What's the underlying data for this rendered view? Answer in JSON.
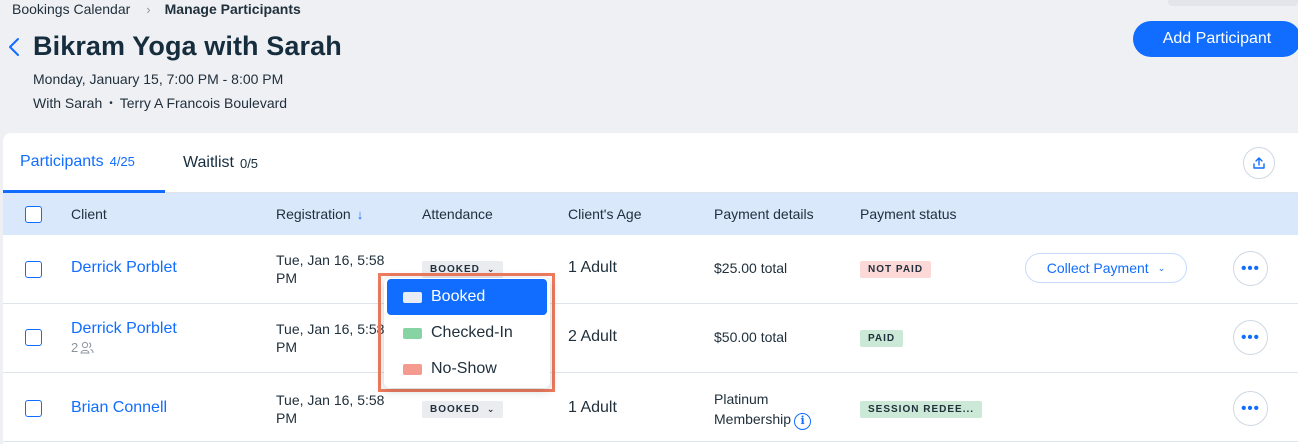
{
  "breadcrumb": {
    "parent": "Bookings Calendar",
    "separator": "›",
    "current": "Manage Participants"
  },
  "header": {
    "title": "Bikram Yoga with Sarah",
    "datetime": "Monday, January 15, 7:00 PM - 8:00 PM",
    "staff": "With Sarah",
    "bullet": "•",
    "location": "Terry A Francois Boulevard",
    "add_button": "Add Participant"
  },
  "tabs": [
    {
      "label": "Participants",
      "count": "4/25",
      "active": true
    },
    {
      "label": "Waitlist",
      "count": "0/5",
      "active": false
    }
  ],
  "table": {
    "columns": {
      "client": "Client",
      "registration": "Registration",
      "sort_arrow": "↓",
      "attendance": "Attendance",
      "age": "Client's Age",
      "payment_details": "Payment details",
      "payment_status": "Payment status"
    },
    "rows": [
      {
        "client": "Derrick Porblet",
        "group": "",
        "registration": "Tue, Jan 16, 5:58 PM",
        "attendance": "BOOKED",
        "age": "1 Adult",
        "payment_details": "$25.00 total",
        "payment_status": "NOT PAID",
        "action": "Collect Payment"
      },
      {
        "client": "Derrick Porblet",
        "group": "2",
        "registration": "Tue, Jan 16, 5:58 PM",
        "attendance": "BOOKED",
        "age": "2 Adult",
        "payment_details": "$50.00 total",
        "payment_status": "PAID",
        "action": ""
      },
      {
        "client": "Brian Connell",
        "group": "",
        "registration": "Tue, Jan 16, 5:58 PM",
        "attendance": "BOOKED",
        "age": "1 Adult",
        "payment_details": "Platinum Membership",
        "payment_status": "SESSION REDEE...",
        "action": ""
      }
    ],
    "more_label": "•••"
  },
  "attendance_dropdown": {
    "options": [
      {
        "label": "Booked",
        "color": "#e8edf5",
        "selected": true
      },
      {
        "label": "Checked-In",
        "color": "#86d4a3",
        "selected": false
      },
      {
        "label": "No-Show",
        "color": "#f59a8f",
        "selected": false
      }
    ]
  },
  "colors": {
    "accent": "#116dff",
    "highlight_outline": "#f07b5d",
    "header_bg": "#dae8fc",
    "page_bg": "#eff0f4"
  },
  "icons": {
    "back": "chevron-left-icon",
    "export": "upload-icon",
    "group": "people-icon",
    "info": "info-icon",
    "more": "more-horizontal-icon"
  }
}
